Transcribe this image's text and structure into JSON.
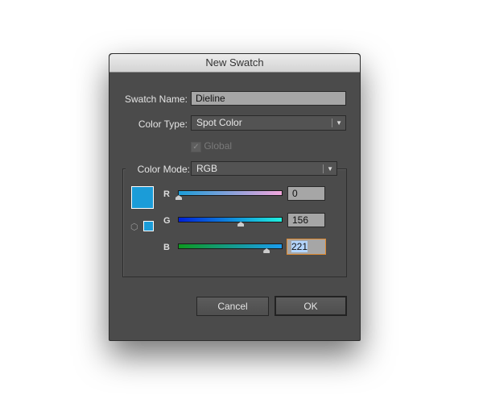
{
  "dialog": {
    "title": "New Swatch"
  },
  "swatch_name": {
    "label": "Swatch Name:",
    "value": "Dieline"
  },
  "color_type": {
    "label": "Color Type:",
    "value": "Spot Color"
  },
  "global": {
    "label": "Global",
    "checked": true,
    "enabled": false
  },
  "color_mode": {
    "label": "Color Mode:",
    "value": "RGB"
  },
  "color": {
    "hex": "#009CDD",
    "out_of_gamut_icon": "cube-icon"
  },
  "channels": [
    {
      "label": "R",
      "value": "0",
      "fraction": 0
    },
    {
      "label": "G",
      "value": "156",
      "fraction": 0.612
    },
    {
      "label": "B",
      "value": "221",
      "fraction": 0.867
    }
  ],
  "buttons": {
    "cancel": "Cancel",
    "ok": "OK"
  }
}
